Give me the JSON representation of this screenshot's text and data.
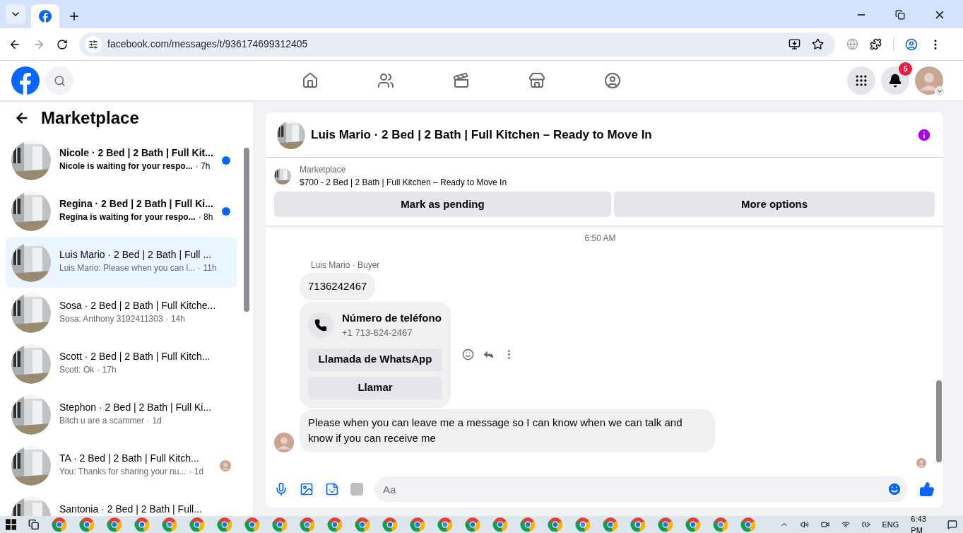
{
  "browser": {
    "url": "facebook.com/messages/t/936174699312405"
  },
  "nav": {
    "notification_count": "5"
  },
  "sidebar": {
    "title": "Marketplace",
    "conversations": [
      {
        "title": "Nicole · 2 Bed | 2 Bath | Full Kit...",
        "preview": "Nicole is waiting for your respo...",
        "time": "· 7h",
        "unread": true,
        "selected": false,
        "seen_avatar": false
      },
      {
        "title": "Regina · 2 Bed | 2 Bath | Full Ki...",
        "preview": "Regina is waiting for your respo...",
        "time": "· 8h",
        "unread": true,
        "selected": false,
        "seen_avatar": false
      },
      {
        "title": "Luis Mario · 2 Bed | 2 Bath | Full ...",
        "preview": "Luis Mario: Please when you can l...",
        "time": "· 11h",
        "unread": false,
        "selected": true,
        "seen_avatar": false
      },
      {
        "title": "Sosa · 2 Bed | 2 Bath | Full Kitche...",
        "preview": "Sosa: Anthony 3192411303",
        "time": "· 14h",
        "unread": false,
        "selected": false,
        "seen_avatar": false
      },
      {
        "title": "Scott · 2 Bed | 2 Bath | Full Kitch...",
        "preview": "Scott: Ok",
        "time": "· 17h",
        "unread": false,
        "selected": false,
        "seen_avatar": false
      },
      {
        "title": "Stephon · 2 Bed | 2 Bath | Full Ki...",
        "preview": "Bitch u are a scammer",
        "time": "· 1d",
        "unread": false,
        "selected": false,
        "seen_avatar": false
      },
      {
        "title": "TA · 2 Bed | 2 Bath | Full Kitch...",
        "preview": "You: Thanks for sharing your nu...",
        "time": "· 1d",
        "unread": false,
        "selected": false,
        "seen_avatar": true
      },
      {
        "title": "Santonia · 2 Bed | 2 Bath | Full...",
        "unread": false,
        "selected": false,
        "seen_avatar": false
      }
    ]
  },
  "chat": {
    "title": "Luis Mario · 2 Bed | 2 Bath | Full Kitchen – Ready to Move In",
    "listing": {
      "label": "Marketplace",
      "name": "$700 - 2 Bed | 2 Bath | Full Kitchen – Ready to Move In"
    },
    "actions": [
      "Mark as pending",
      "More options"
    ],
    "timestamp": "6:50 AM",
    "sender": "Luis Mario · Buyer",
    "messages": [
      {
        "kind": "text",
        "text": "7136242467"
      },
      {
        "kind": "phone",
        "title": "Número de teléfono",
        "number": "+1 713-624-2467",
        "buttons": [
          "Llamada de WhatsApp",
          "Llamar"
        ]
      },
      {
        "kind": "text",
        "text": "Please when you can leave me a message so I can know when we can talk and know if you can receive me"
      }
    ],
    "composer": {
      "placeholder": "Aa"
    }
  },
  "taskbar": {
    "language": "ENG",
    "time": "6:43 PM"
  }
}
